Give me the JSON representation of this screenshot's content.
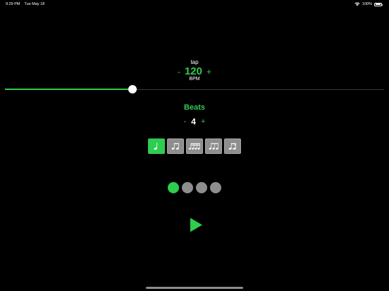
{
  "status_bar": {
    "time": "9:29 PM",
    "date": "Tue May 18",
    "battery": "100%"
  },
  "tempo": {
    "tap_label": "tap",
    "minus": "-",
    "value": "120",
    "plus": "+",
    "unit": "BPM",
    "slider_fraction": 0.337
  },
  "beats": {
    "title": "Beats",
    "minus": "-",
    "value": "4",
    "plus": "+"
  },
  "subdivisions": [
    {
      "name": "quarter-note",
      "active": true
    },
    {
      "name": "eighth-notes",
      "active": false
    },
    {
      "name": "sixteenth-notes",
      "active": false
    },
    {
      "name": "triplet-notes",
      "active": false
    },
    {
      "name": "dotted-rhythm-notes",
      "active": false
    }
  ],
  "beat_indicators": {
    "count": 4,
    "current": 1
  },
  "colors": {
    "accent": "#2ecc4f",
    "inactive": "#8e8e8e",
    "background": "#000000"
  }
}
